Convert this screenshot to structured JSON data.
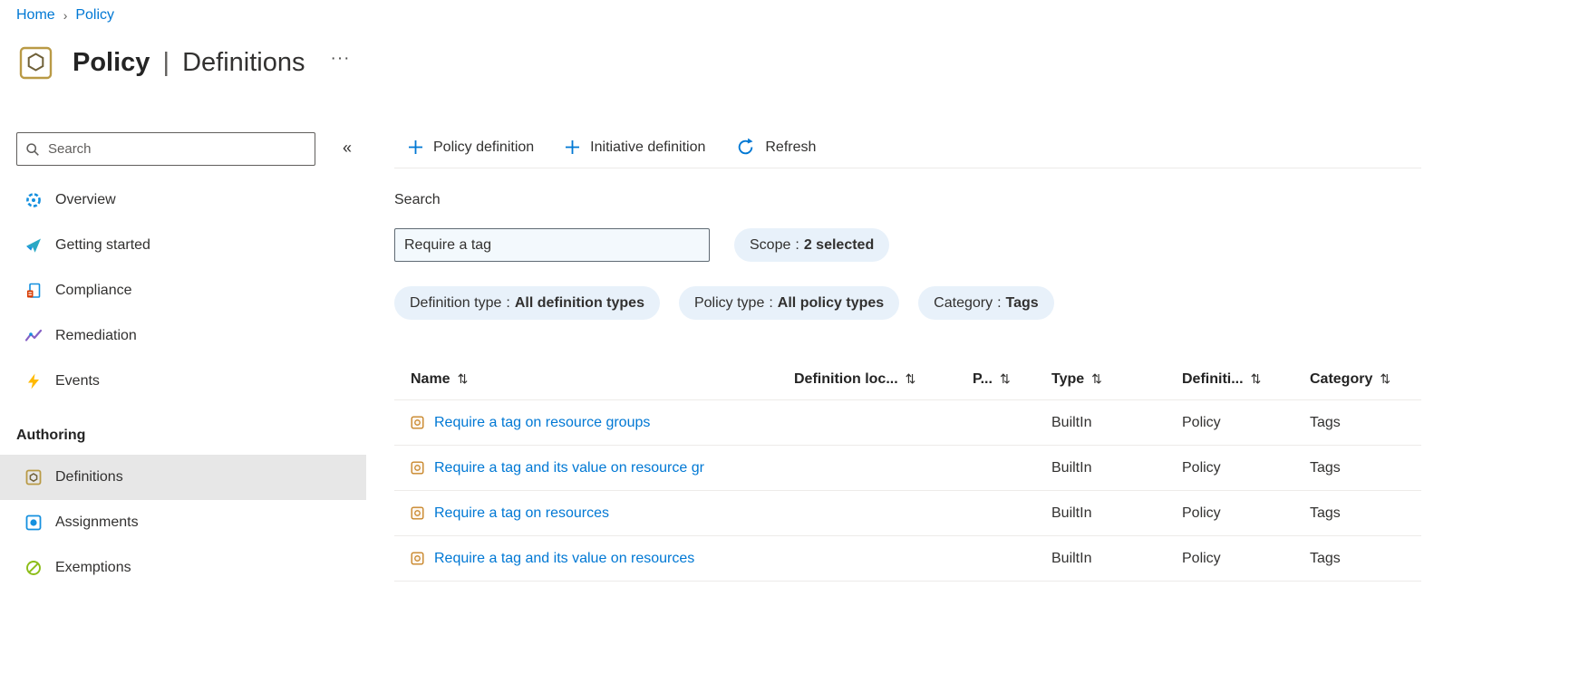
{
  "colors": {
    "accent": "#0078d4",
    "selected_bg": "#e7e7e7",
    "pill_bg": "#e8f1fa"
  },
  "breadcrumb": {
    "separator": "›",
    "items": [
      {
        "label": "Home"
      },
      {
        "label": "Policy"
      }
    ]
  },
  "header": {
    "title_primary": "Policy",
    "title_separator": "|",
    "title_secondary": "Definitions",
    "more_glyph": "···"
  },
  "sidebar": {
    "search_placeholder": "Search",
    "collapse_glyph": "«",
    "items": [
      {
        "label": "Overview",
        "icon": "overview-icon"
      },
      {
        "label": "Getting started",
        "icon": "getting-started-icon"
      },
      {
        "label": "Compliance",
        "icon": "compliance-icon"
      },
      {
        "label": "Remediation",
        "icon": "remediation-icon"
      },
      {
        "label": "Events",
        "icon": "events-icon"
      }
    ],
    "section_label": "Authoring",
    "authoring": [
      {
        "label": "Definitions",
        "icon": "definitions-icon",
        "selected": true
      },
      {
        "label": "Assignments",
        "icon": "assignments-icon",
        "selected": false
      },
      {
        "label": "Exemptions",
        "icon": "exemptions-icon",
        "selected": false
      }
    ]
  },
  "commandbar": {
    "policy_definition": "Policy definition",
    "initiative_definition": "Initiative definition",
    "refresh": "Refresh"
  },
  "filters": {
    "search_label": "Search",
    "search_value": "Require a tag",
    "pills": [
      {
        "name": "Scope",
        "value": "2 selected"
      },
      {
        "name": "Definition type",
        "value": "All definition types"
      },
      {
        "name": "Policy type",
        "value": "All policy types"
      },
      {
        "name": "Category",
        "value": "Tags"
      }
    ]
  },
  "table": {
    "sort_glyph": "⇅",
    "columns": [
      {
        "label": "Name"
      },
      {
        "label": "Definition loc..."
      },
      {
        "label": "P..."
      },
      {
        "label": "Type"
      },
      {
        "label": "Definiti..."
      },
      {
        "label": "Category"
      }
    ],
    "rows": [
      {
        "name": "Require a tag on resource groups",
        "type": "BuiltIn",
        "definition_type": "Policy",
        "category": "Tags"
      },
      {
        "name": "Require a tag and its value on resource gr",
        "type": "BuiltIn",
        "definition_type": "Policy",
        "category": "Tags"
      },
      {
        "name": "Require a tag on resources",
        "type": "BuiltIn",
        "definition_type": "Policy",
        "category": "Tags"
      },
      {
        "name": "Require a tag and its value on resources",
        "type": "BuiltIn",
        "definition_type": "Policy",
        "category": "Tags"
      }
    ]
  }
}
